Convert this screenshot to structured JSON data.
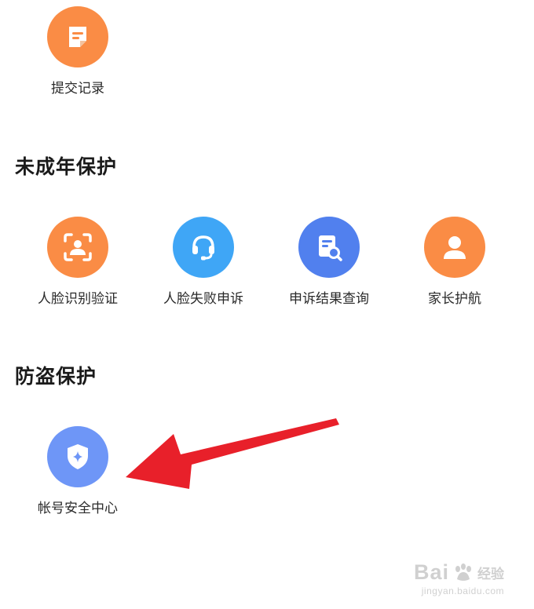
{
  "top": {
    "items": [
      {
        "label": "提交记录",
        "icon": "document-icon",
        "color": "#FA8C45"
      }
    ]
  },
  "minor_protection": {
    "title": "未成年保护",
    "items": [
      {
        "label": "人脸识别验证",
        "icon": "face-scan-icon",
        "color": "#FA8C45"
      },
      {
        "label": "人脸失败申诉",
        "icon": "headset-icon",
        "color": "#3FA6F6"
      },
      {
        "label": "申诉结果查询",
        "icon": "document-search-icon",
        "color": "#5180EE"
      },
      {
        "label": "家长护航",
        "icon": "person-icon",
        "color": "#FA8C45"
      }
    ]
  },
  "theft_protection": {
    "title": "防盗保护",
    "items": [
      {
        "label": "帐号安全中心",
        "icon": "shield-icon",
        "color": "#6E96F7"
      }
    ]
  },
  "annotation": {
    "arrow_color": "#E8202A"
  },
  "watermark": {
    "brand": "Bai",
    "sub": "经验",
    "url": "jingyan.baidu.com"
  }
}
